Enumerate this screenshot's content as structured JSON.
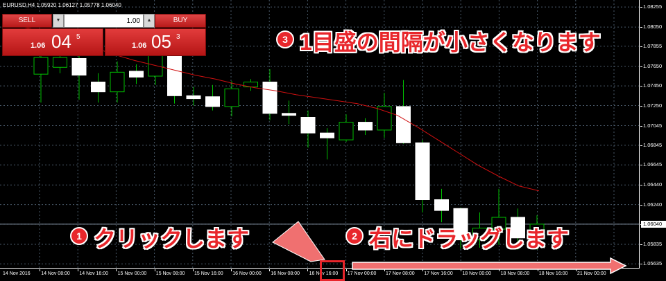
{
  "window": {
    "symbol_title": "EURUSD,H4  1.05920 1.06127 1.05778 1.06040"
  },
  "trade_panel": {
    "sell_label": "SELL",
    "buy_label": "BUY",
    "lot_value": "1.00",
    "sell_quote": {
      "prefix": "1.06",
      "big": "04",
      "sup": "5"
    },
    "buy_quote": {
      "prefix": "1.06",
      "big": "05",
      "sup": "3"
    },
    "down_arrow": "▼",
    "up_arrow": "▲"
  },
  "price_axis": {
    "labels": [
      "1.08255",
      "1.08050",
      "1.07855",
      "1.07650",
      "1.07450",
      "1.07250",
      "1.07045",
      "1.06845",
      "1.06645",
      "1.06440",
      "1.06240",
      "1.06040",
      "1.05835",
      "1.05635"
    ],
    "current_price": "1.06040"
  },
  "time_axis": {
    "labels": [
      "14 Nov 2016",
      "14 Nov 08:00",
      "14 Nov 16:00",
      "15 Nov 00:00",
      "15 Nov 08:00",
      "15 Nov 16:00",
      "16 Nov 00:00",
      "16 Nov 08:00",
      "16 Nov 16:00",
      "17 Nov 00:00",
      "17 Nov 08:00",
      "17 Nov 16:00",
      "18 Nov 00:00",
      "18 Nov 08:00",
      "18 Nov 16:00",
      "21 Nov 00:00"
    ]
  },
  "annotations": {
    "step1": {
      "number": "1",
      "text": "クリックします"
    },
    "step2": {
      "number": "2",
      "text": "右にドラッグします"
    },
    "step3": {
      "number": "3",
      "text": "1目盛の間隔が小さくなります"
    }
  },
  "colors": {
    "bull_candle": "#ffffff",
    "wick": "#00c000",
    "moving_average": "#d01010",
    "grid": "#4a5a6a",
    "annotation_red": "#e8262b",
    "arrow_fill": "#f07070"
  },
  "chart_data": {
    "type": "candlestick",
    "ylim": [
      1.0563,
      1.0827
    ],
    "candles": [
      {
        "open": 1.0757,
        "high": 1.0796,
        "low": 1.0728,
        "close": 1.0774
      },
      {
        "open": 1.0764,
        "high": 1.0779,
        "low": 1.0758,
        "close": 1.0774
      },
      {
        "open": 1.0773,
        "high": 1.0778,
        "low": 1.0731,
        "close": 1.0756
      },
      {
        "open": 1.0749,
        "high": 1.0758,
        "low": 1.0728,
        "close": 1.0739
      },
      {
        "open": 1.0739,
        "high": 1.077,
        "low": 1.0728,
        "close": 1.0759
      },
      {
        "open": 1.076,
        "high": 1.0767,
        "low": 1.0747,
        "close": 1.0754
      },
      {
        "open": 1.0755,
        "high": 1.079,
        "low": 1.0746,
        "close": 1.0783
      },
      {
        "open": 1.0782,
        "high": 1.0789,
        "low": 1.0727,
        "close": 1.0735
      },
      {
        "open": 1.0735,
        "high": 1.0744,
        "low": 1.0725,
        "close": 1.0732
      },
      {
        "open": 1.0734,
        "high": 1.0746,
        "low": 1.072,
        "close": 1.0724
      },
      {
        "open": 1.0724,
        "high": 1.075,
        "low": 1.0714,
        "close": 1.0742
      },
      {
        "open": 1.0744,
        "high": 1.0752,
        "low": 1.074,
        "close": 1.0749
      },
      {
        "open": 1.0749,
        "high": 1.0762,
        "low": 1.071,
        "close": 1.0717
      },
      {
        "open": 1.0717,
        "high": 1.073,
        "low": 1.0706,
        "close": 1.0715
      },
      {
        "open": 1.0713,
        "high": 1.072,
        "low": 1.0682,
        "close": 1.0697
      },
      {
        "open": 1.0697,
        "high": 1.0702,
        "low": 1.067,
        "close": 1.0692
      },
      {
        "open": 1.069,
        "high": 1.0716,
        "low": 1.0688,
        "close": 1.0708
      },
      {
        "open": 1.0708,
        "high": 1.0712,
        "low": 1.0695,
        "close": 1.07
      },
      {
        "open": 1.07,
        "high": 1.0738,
        "low": 1.0692,
        "close": 1.0724
      },
      {
        "open": 1.0724,
        "high": 1.0751,
        "low": 1.0686,
        "close": 1.0687
      },
      {
        "open": 1.0687,
        "high": 1.069,
        "low": 1.0616,
        "close": 1.0629
      },
      {
        "open": 1.0629,
        "high": 1.064,
        "low": 1.0606,
        "close": 1.0618
      },
      {
        "open": 1.062,
        "high": 1.0621,
        "low": 1.0579,
        "close": 1.0588
      },
      {
        "open": 1.0588,
        "high": 1.0616,
        "low": 1.058,
        "close": 1.06
      },
      {
        "open": 1.0599,
        "high": 1.064,
        "low": 1.0583,
        "close": 1.0611
      },
      {
        "open": 1.0611,
        "high": 1.062,
        "low": 1.0578,
        "close": 1.059
      },
      {
        "open": 1.0593,
        "high": 1.0613,
        "low": 1.0578,
        "close": 1.0604
      }
    ],
    "moving_average": [
      1.0807,
      1.0803,
      1.0797,
      1.079,
      1.0784,
      1.0777,
      1.0771,
      1.0766,
      1.0761,
      1.0756,
      1.0752,
      1.0747,
      1.0743,
      1.074,
      1.0736,
      1.0733,
      1.073,
      1.0727,
      1.0722,
      1.0715,
      1.0703,
      1.069,
      1.0677,
      1.0664,
      1.0653,
      1.0643,
      1.0638
    ]
  }
}
